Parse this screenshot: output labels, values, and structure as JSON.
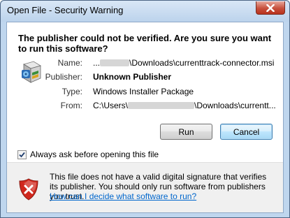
{
  "window": {
    "title": "Open File - Security Warning",
    "close_icon": "close-icon"
  },
  "headline": "The publisher could not be verified.  Are you sure you want to run this software?",
  "file_icon": "windows-installer-package-icon",
  "fields": {
    "name_label": "Name:",
    "name_prefix": "...",
    "name_suffix": "\\Downloads\\currenttrack-connector.msi",
    "publisher_label": "Publisher:",
    "publisher_value": "Unknown Publisher",
    "type_label": "Type:",
    "type_value": "Windows Installer Package",
    "from_label": "From:",
    "from_prefix": "C:\\Users\\",
    "from_suffix": "\\Downloads\\currentt..."
  },
  "buttons": {
    "run": "Run",
    "cancel": "Cancel"
  },
  "checkbox": {
    "label": "Always ask before opening this file",
    "checked": true
  },
  "warning": {
    "icon": "shield-error-icon",
    "text": "This file does not have a valid digital signature that verifies its publisher.  You should only run software from publishers you trust.",
    "link": "How can I decide what software to run?"
  },
  "colors": {
    "frame": "#bfd6ee",
    "link": "#0066cc",
    "close": "#c7503c",
    "shield_red": "#d0281e"
  }
}
